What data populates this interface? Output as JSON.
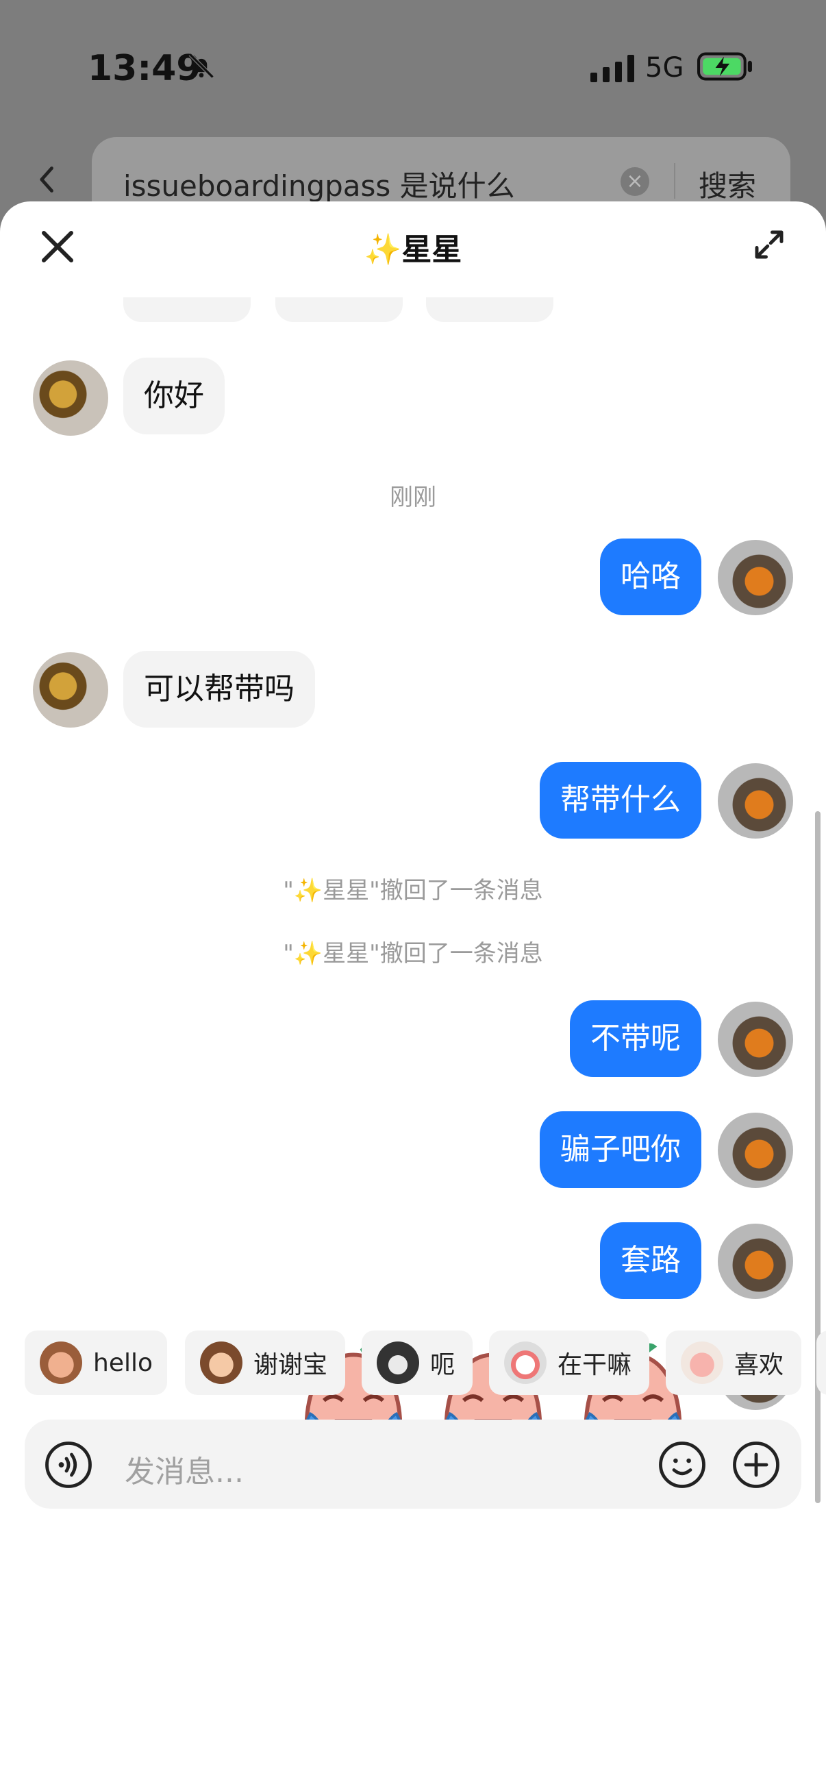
{
  "status_bar": {
    "time": "13:49",
    "network": "5G",
    "icons": [
      "bell-off-icon",
      "signal-icon",
      "battery-charging-icon"
    ]
  },
  "search": {
    "query": "issueboardingpass 是说什么",
    "clear_icon": "clear-icon",
    "button_label": "搜索",
    "back_icon": "chevron-left-icon"
  },
  "chat": {
    "title": "✨星星",
    "close_icon": "close-icon",
    "expand_icon": "expand-icon",
    "messages": [
      {
        "side": "in",
        "text": "你好"
      },
      {
        "type": "time",
        "text": "刚刚"
      },
      {
        "side": "out",
        "text": "哈咯"
      },
      {
        "side": "in",
        "text": "可以帮带吗"
      },
      {
        "side": "out",
        "text": "帮带什么"
      },
      {
        "type": "system",
        "text": "\"✨星星\"撤回了一条消息"
      },
      {
        "type": "system",
        "text": "\"✨星星\"撤回了一条消息"
      },
      {
        "side": "out",
        "text": "不带呢"
      },
      {
        "side": "out",
        "text": "骗子吧你"
      },
      {
        "side": "out",
        "text": "套路"
      }
    ],
    "sticker_message": {
      "side": "out",
      "stickers": [
        "crying-laughing-sticker",
        "crying-laughing-sticker",
        "crying-laughing-sticker"
      ]
    }
  },
  "quick_stickers": [
    {
      "label": "hello",
      "icon": "monkey-wave-icon"
    },
    {
      "label": "谢谢宝",
      "icon": "girl-flower-icon"
    },
    {
      "label": "呃",
      "icon": "cat-icon"
    },
    {
      "label": "在干嘛",
      "icon": "peek-icon"
    },
    {
      "label": "喜欢",
      "icon": "heart-icon"
    }
  ],
  "input": {
    "placeholder": "发消息...",
    "voice_icon": "voice-icon",
    "emoji_icon": "smile-icon",
    "more_icon": "plus-icon"
  },
  "colors": {
    "accent": "#1e7bff",
    "bubble_in": "#f3f3f3"
  }
}
